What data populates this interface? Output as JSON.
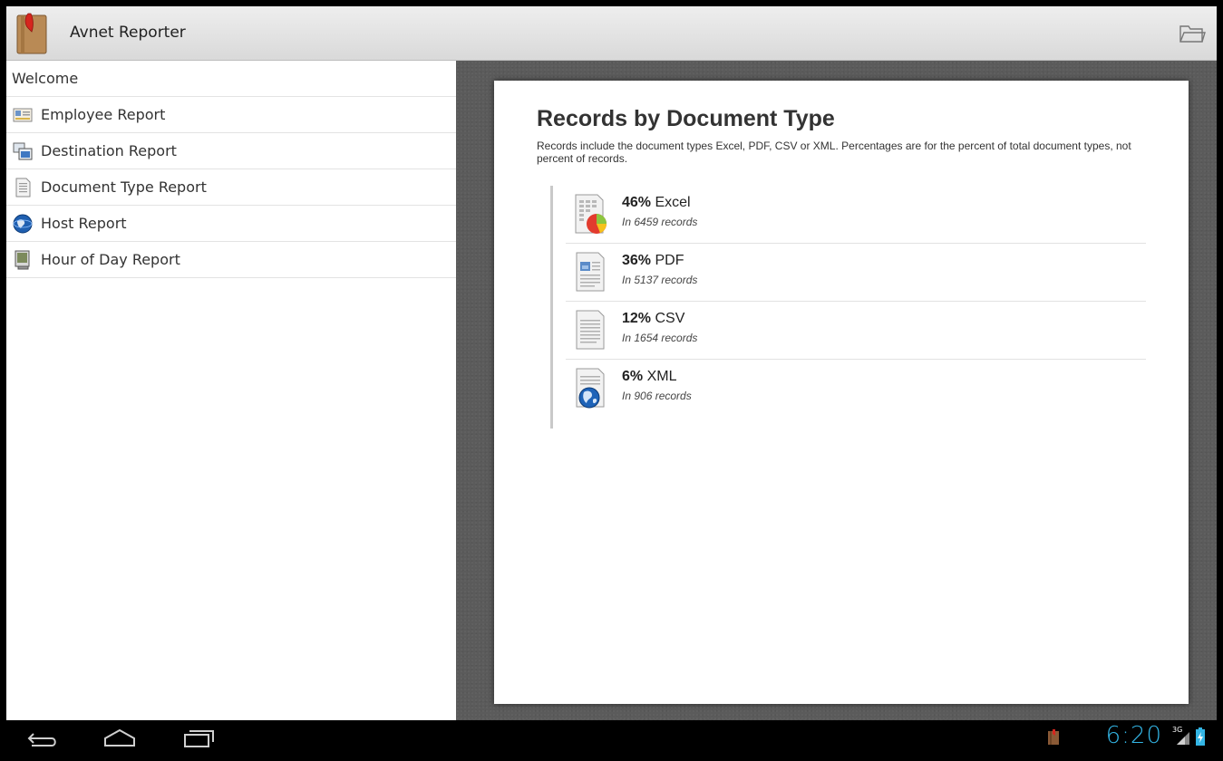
{
  "app": {
    "title": "Avnet Reporter"
  },
  "sidebar": {
    "items": [
      {
        "label": "Welcome",
        "icon": "none"
      },
      {
        "label": "Employee Report",
        "icon": "id-card-icon"
      },
      {
        "label": "Destination Report",
        "icon": "windows-icon"
      },
      {
        "label": "Document Type Report",
        "icon": "document-icon"
      },
      {
        "label": "Host Report",
        "icon": "globe-icon"
      },
      {
        "label": "Hour of Day Report",
        "icon": "monitor-icon"
      }
    ]
  },
  "report": {
    "title": "Records by Document Type",
    "description": "Records include the document types Excel, PDF, CSV or XML. Percentages are for the percent of total document types, not percent of records.",
    "rows": [
      {
        "percent": "46%",
        "type": " Excel",
        "records": "In 6459 records",
        "icon": "excel-chart-icon"
      },
      {
        "percent": "36%",
        "type": " PDF",
        "records": "In 5137 records",
        "icon": "pdf-document-icon"
      },
      {
        "percent": "12%",
        "type": " CSV",
        "records": "In 1654 records",
        "icon": "csv-document-icon"
      },
      {
        "percent": "6%",
        "type": " XML",
        "records": "In 906 records",
        "icon": "xml-globe-icon"
      }
    ]
  },
  "statusbar": {
    "time": "6:20",
    "network": "3G"
  },
  "colors": {
    "clock": "#33b5e5",
    "actionbar": "#e3e3e3",
    "content_bg": "#5b5b5b"
  }
}
